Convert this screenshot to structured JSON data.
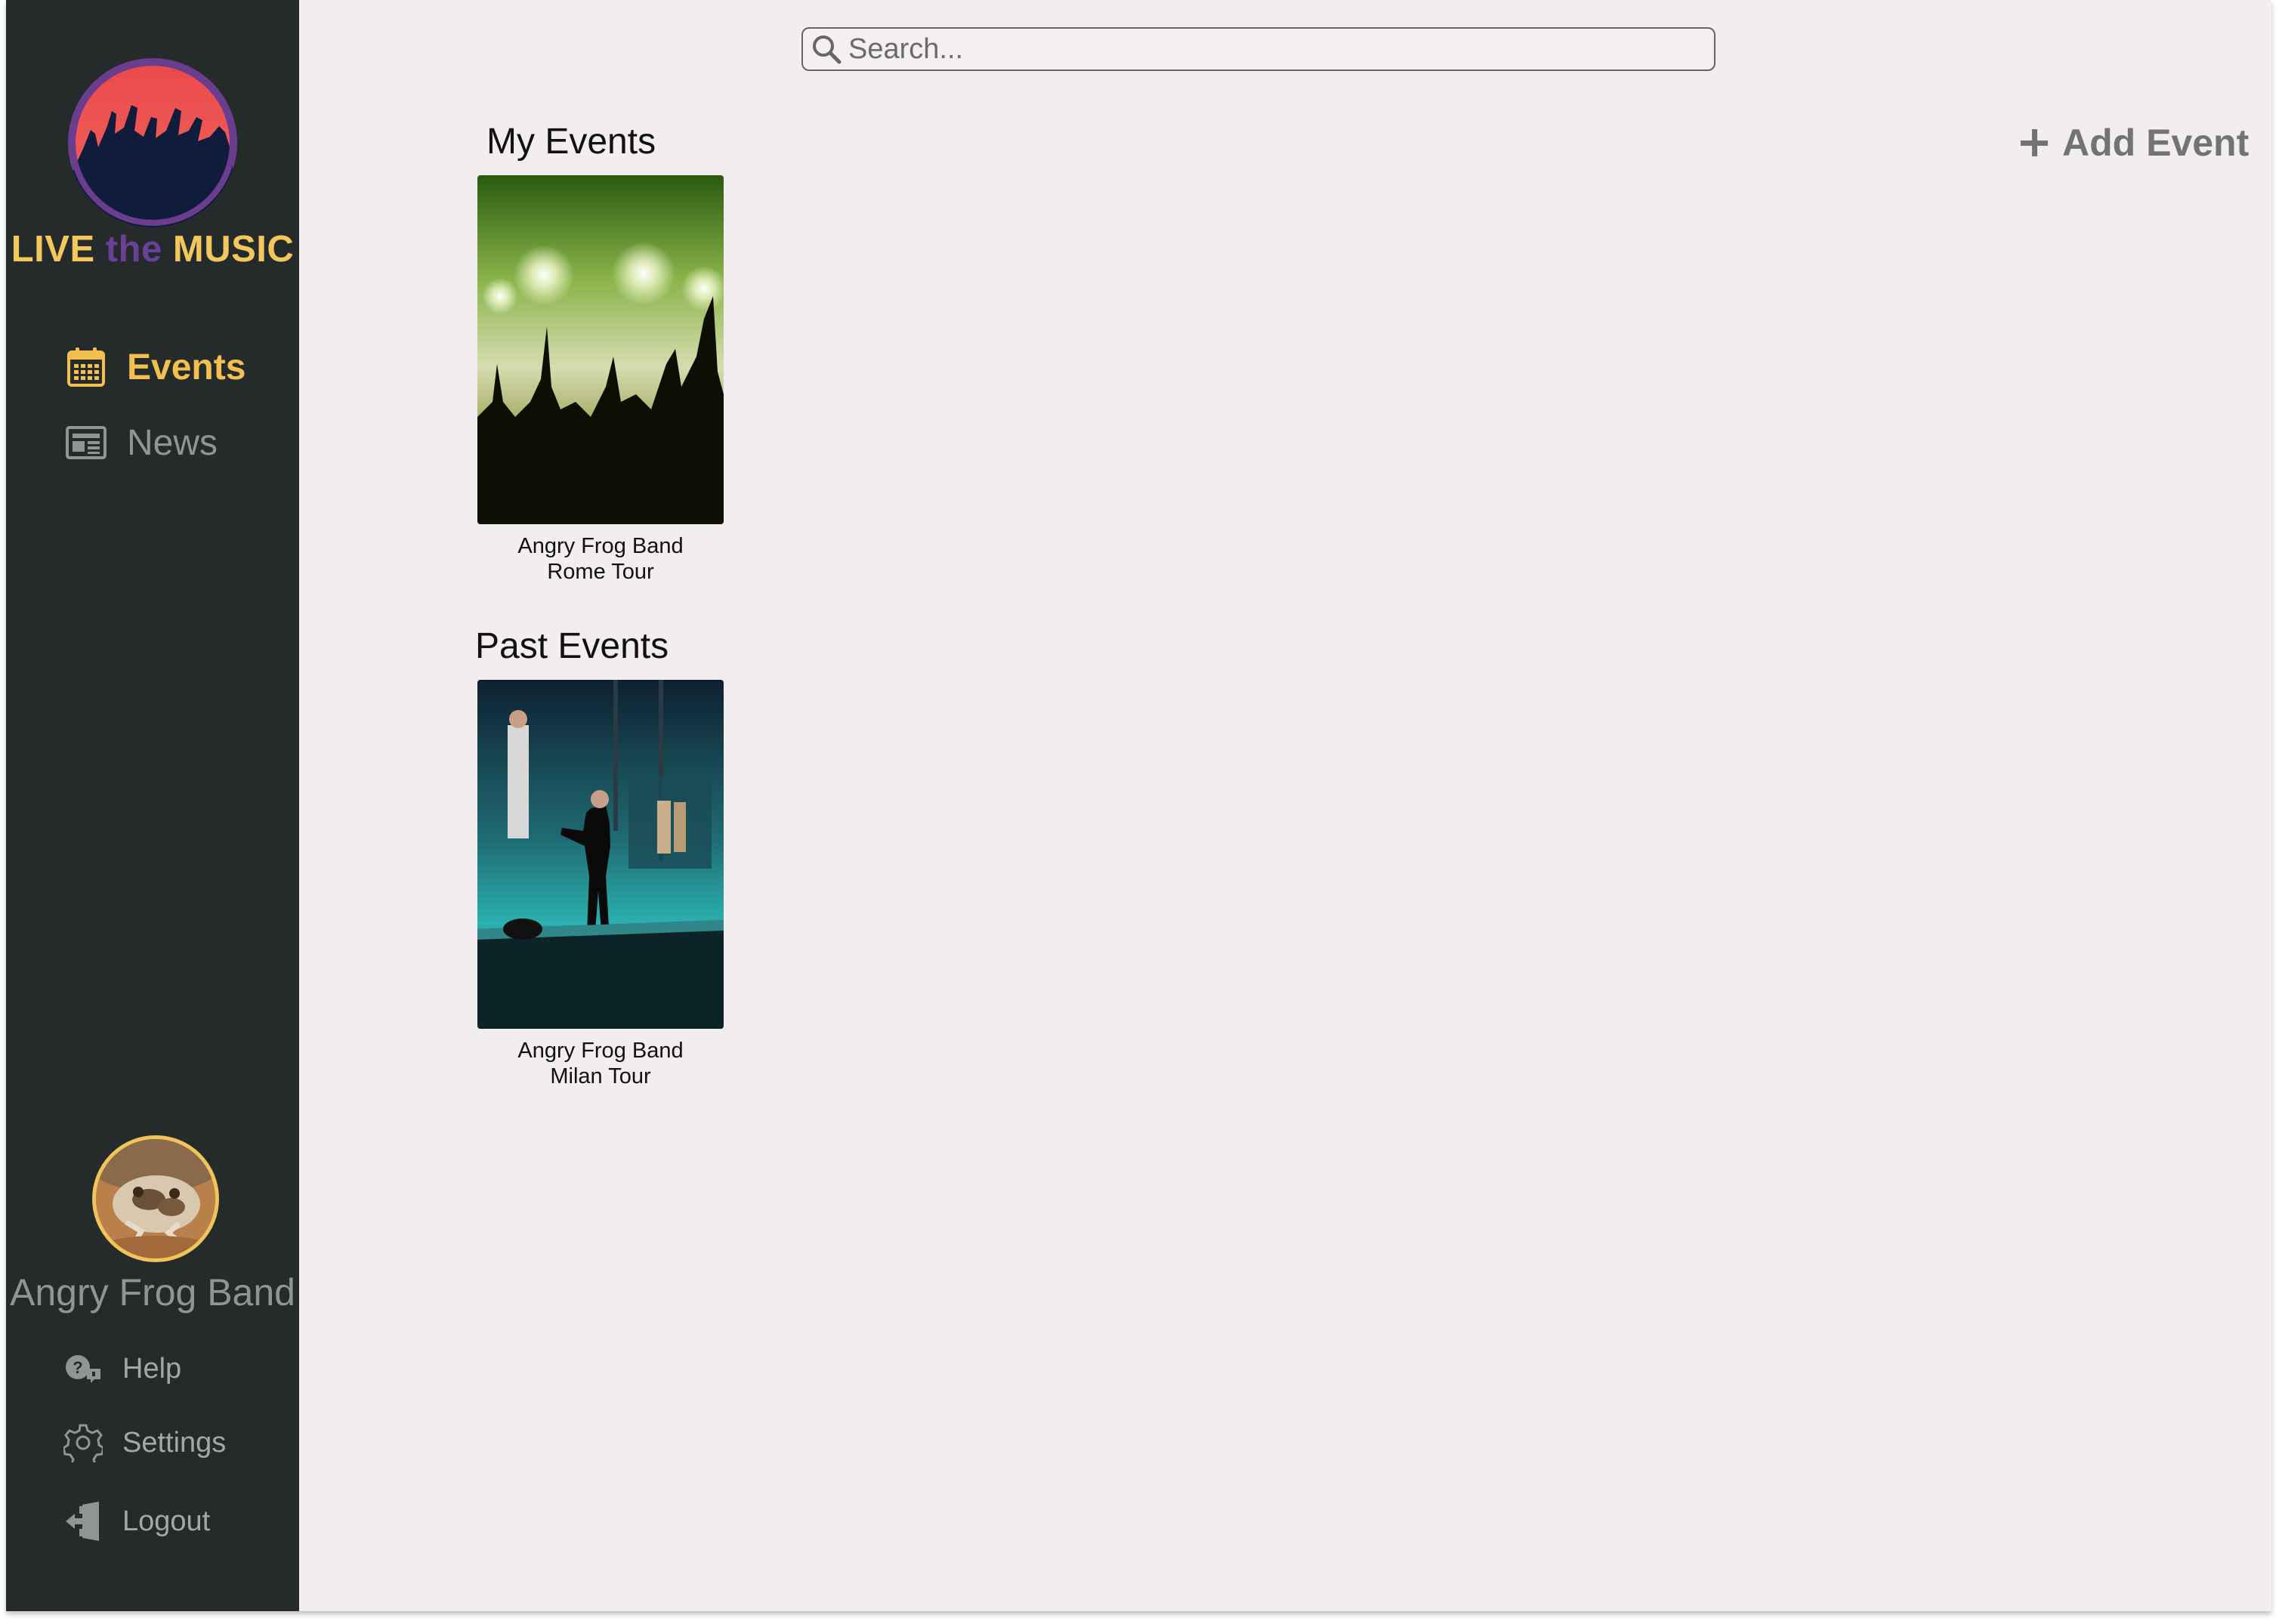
{
  "brand": {
    "part1": "LIVE ",
    "part2": "the",
    "part3": " MUSIC"
  },
  "sidebar": {
    "nav": [
      {
        "label": "Events",
        "icon": "calendar-icon",
        "active": true
      },
      {
        "label": "News",
        "icon": "newspaper-icon",
        "active": false
      }
    ],
    "profile_name": "Angry Frog Band",
    "menu": [
      {
        "label": "Help",
        "icon": "help-icon"
      },
      {
        "label": "Settings",
        "icon": "gear-icon"
      },
      {
        "label": "Logout",
        "icon": "logout-icon"
      }
    ]
  },
  "search": {
    "placeholder": "Search..."
  },
  "header": {
    "add_event": "Add Event"
  },
  "sections": {
    "my_events": {
      "title": "My Events",
      "events": [
        {
          "line1": "Angry Frog Band",
          "line2": "Rome Tour"
        }
      ]
    },
    "past_events": {
      "title": "Past Events",
      "events": [
        {
          "line1": "Angry Frog Band",
          "line2": "Milan Tour"
        }
      ]
    }
  },
  "colors": {
    "sidebar_bg": "#252b2b",
    "main_bg": "#f2edee",
    "accent_yellow": "#f3c04d",
    "accent_purple": "#6a3f97",
    "muted_text": "#8f9595"
  }
}
